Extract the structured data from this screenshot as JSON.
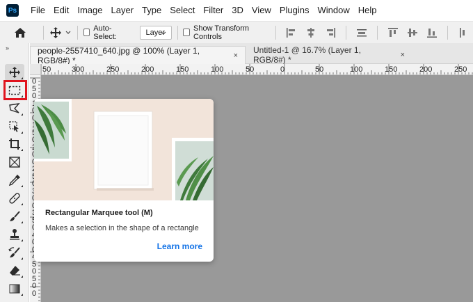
{
  "app": {
    "logo_text": "Ps"
  },
  "menu": [
    "File",
    "Edit",
    "Image",
    "Layer",
    "Type",
    "Select",
    "Filter",
    "3D",
    "View",
    "Plugins",
    "Window",
    "Help"
  ],
  "options_bar": {
    "auto_select_label": "Auto-Select:",
    "auto_select_value": "Layer",
    "show_transform_label": "Show Transform Controls"
  },
  "tabs": [
    {
      "label": "people-2557410_640.jpg @ 100% (Layer 1, RGB/8#) *",
      "close": "×"
    },
    {
      "label": "Untitled-1 @ 16.7% (Layer 1, RGB/8#) *",
      "close": "×"
    }
  ],
  "ruler_top_labels": [
    "50",
    "300",
    "250",
    "200",
    "150",
    "100",
    "50",
    "0",
    "50",
    "100",
    "150",
    "200",
    "250"
  ],
  "ruler_left_labels": [
    "0",
    "5",
    "0",
    "1",
    "0",
    "0",
    "1",
    "5",
    "0",
    "2",
    "0",
    "0",
    "2",
    "5",
    "0",
    "3",
    "0",
    "0",
    "3",
    "5",
    "0",
    "4",
    "0",
    "0",
    "4",
    "5",
    "0",
    "5",
    "0",
    "0"
  ],
  "toolbar": {
    "collapse": "»",
    "tools": [
      "move-tool",
      "rectangular-marquee-tool",
      "lasso-tool",
      "object-selection-tool",
      "crop-tool",
      "frame-tool",
      "eyedropper-tool",
      "spot-healing-brush-tool",
      "brush-tool",
      "clone-stamp-tool",
      "history-brush-tool",
      "eraser-tool",
      "gradient-tool"
    ]
  },
  "tooltip": {
    "title": "Rectangular Marquee tool (M)",
    "description": "Makes a selection in the shape of a rectangle",
    "link": "Learn more"
  },
  "colors": {
    "accent": "#1473e6",
    "highlight": "#e0141e",
    "canvas": "#999999",
    "tooltip_image_bg": "#f2e4da"
  }
}
